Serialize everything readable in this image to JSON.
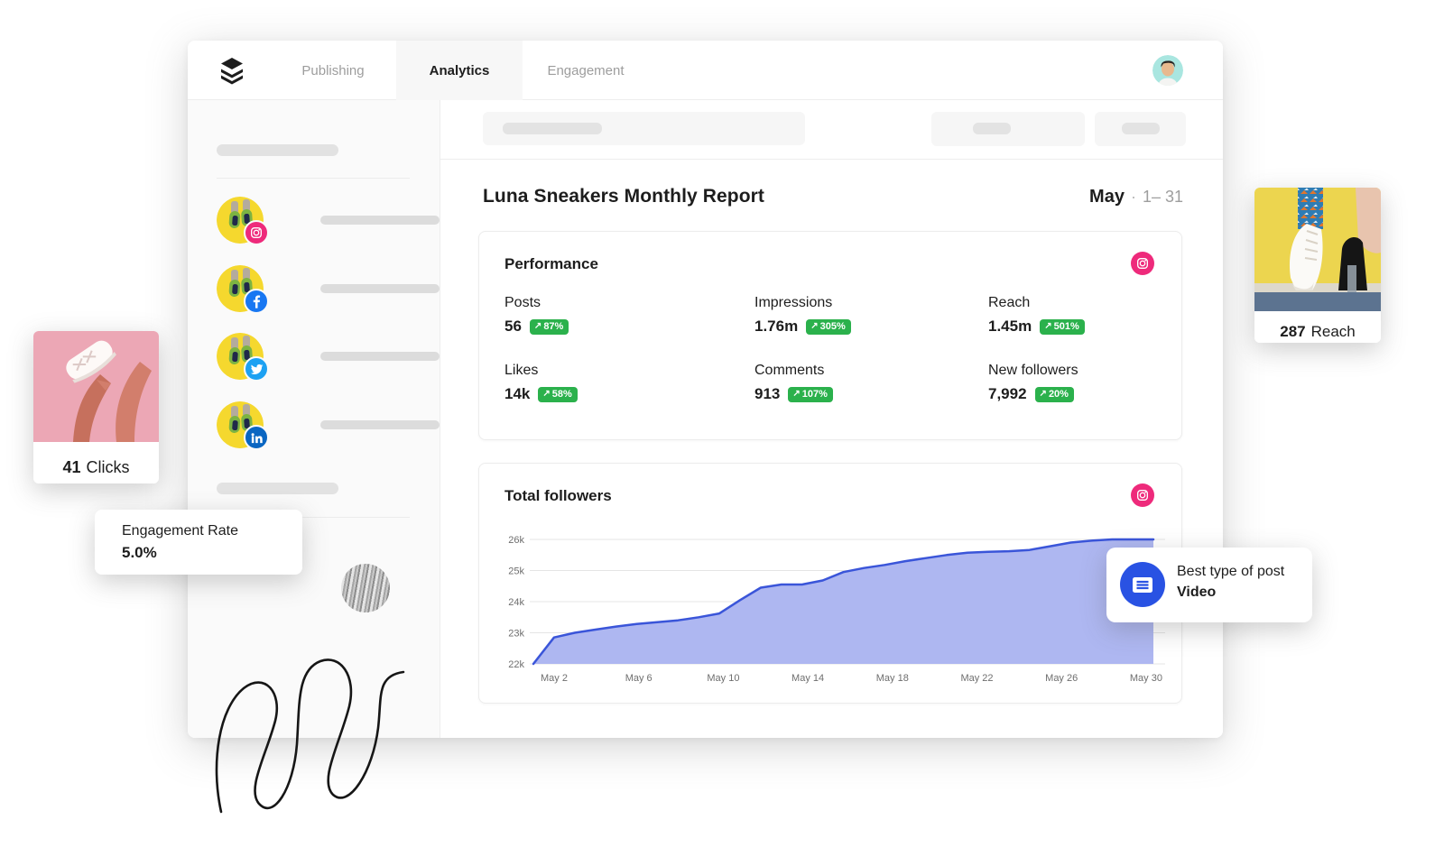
{
  "nav": {
    "logo_icon": "buffer-logo",
    "tabs": [
      {
        "label": "Publishing",
        "active": false
      },
      {
        "label": "Analytics",
        "active": true
      },
      {
        "label": "Engagement",
        "active": false
      }
    ]
  },
  "report": {
    "title": "Luna Sneakers Monthly Report",
    "month": "May",
    "separator": "·",
    "date_range": "1– 31"
  },
  "performance": {
    "title": "Performance",
    "network_icon": "instagram-icon",
    "up_arrow": "↗",
    "stats": [
      {
        "label": "Posts",
        "value": "56",
        "change": "87%"
      },
      {
        "label": "Impressions",
        "value": "1.76m",
        "change": "305%"
      },
      {
        "label": "Reach",
        "value": "1.45m",
        "change": "501%"
      },
      {
        "label": "Likes",
        "value": "14k",
        "change": "58%"
      },
      {
        "label": "Comments",
        "value": "913",
        "change": "107%"
      },
      {
        "label": "New followers",
        "value": "7,992",
        "change": "20%"
      }
    ]
  },
  "chart_data": {
    "type": "area",
    "title": "Total followers",
    "network_icon": "instagram-icon",
    "x": [
      "May 1",
      "May 2",
      "May 3",
      "May 4",
      "May 5",
      "May 6",
      "May 7",
      "May 8",
      "May 9",
      "May 10",
      "May 11",
      "May 12",
      "May 13",
      "May 14",
      "May 15",
      "May 16",
      "May 17",
      "May 18",
      "May 19",
      "May 20",
      "May 21",
      "May 22",
      "May 23",
      "May 24",
      "May 25",
      "May 26",
      "May 27",
      "May 28",
      "May 29",
      "May 30",
      "May 31"
    ],
    "values_thousands": [
      22.0,
      22.85,
      23.0,
      23.1,
      23.2,
      23.28,
      23.34,
      23.4,
      23.5,
      23.62,
      24.05,
      24.45,
      24.55,
      24.55,
      24.68,
      24.95,
      25.08,
      25.18,
      25.3,
      25.4,
      25.5,
      25.57,
      25.6,
      25.62,
      25.66,
      25.78,
      25.9,
      25.96,
      26.0,
      26.0,
      26.0
    ],
    "ylim_thousands": [
      22,
      26
    ],
    "y_tick_labels": [
      "26k",
      "25k",
      "24k",
      "23k",
      "22k"
    ],
    "x_tick_labels": [
      "May 2",
      "May 6",
      "May 10",
      "May 14",
      "May 18",
      "May 22",
      "May 26",
      "May 30"
    ],
    "grid": true,
    "legend": "none",
    "line_color": "#3a55d9",
    "fill_color": "#aeb7f1"
  },
  "sidebar": {
    "channels": [
      {
        "network": "instagram"
      },
      {
        "network": "facebook"
      },
      {
        "network": "twitter"
      },
      {
        "network": "linkedin"
      }
    ]
  },
  "floating_cards": {
    "reach": {
      "value": "287",
      "label": "Reach"
    },
    "clicks": {
      "value": "41",
      "label": "Clicks"
    },
    "engagement": {
      "label": "Engagement Rate",
      "value": "5.0%"
    },
    "best_post": {
      "label": "Best type of post",
      "value": "Video",
      "icon": "post-icon"
    }
  },
  "colors": {
    "positive_green": "#2bb14c",
    "chart_line": "#3a55d9",
    "chart_fill": "#aeb7f1",
    "instagram_pink": "#ee2a7b",
    "facebook_blue": "#1877f2",
    "twitter_blue": "#1da1f2",
    "linkedin_blue": "#0a66c2",
    "accent_blue": "#2952e3",
    "avatar_yellow": "#f5d82e"
  }
}
